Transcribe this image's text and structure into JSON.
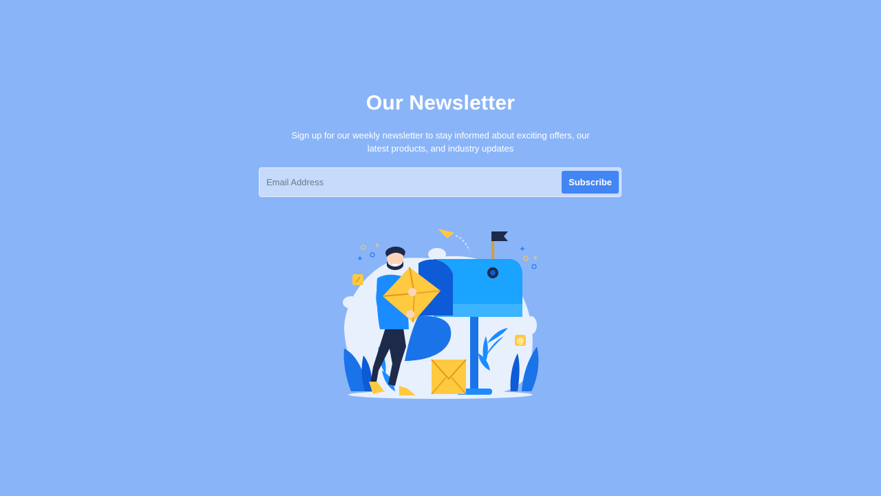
{
  "newsletter": {
    "title": "Our Newsletter",
    "subtitle": "Sign up for our weekly newsletter to stay informed about exciting offers, our latest products, and industry updates",
    "email_placeholder": "Email Address",
    "email_value": "",
    "subscribe_label": "Subscribe"
  },
  "illustration": {
    "icon": "newsletter-mailbox-illustration",
    "at_symbol": "@"
  },
  "colors": {
    "background": "#8ab4f8",
    "accent": "#4285f4",
    "input_background": "#c6dafc",
    "illustration_blue": "#1a8cff",
    "illustration_yellow": "#ffc940"
  }
}
